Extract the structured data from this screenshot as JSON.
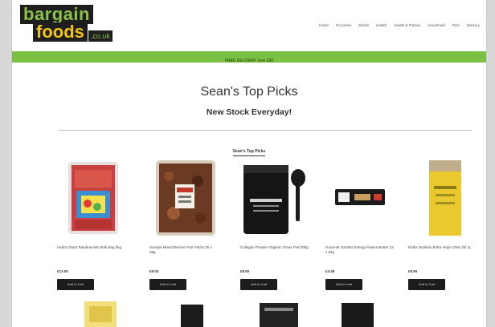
{
  "logo": {
    "line1": "bargain",
    "line2": "foods",
    "domain": ".co.uk"
  },
  "nav": [
    "Home",
    "Groceries",
    "Drinks",
    "Health",
    "Health & Fitness",
    "Household",
    "Pets",
    "Delivery"
  ],
  "banner": {
    "text": "FREE DELIVERY over £50"
  },
  "page": {
    "title": "Sean's Top Picks",
    "subtitle": "New Stock Everyday!",
    "tab": "Sean's Top Picks"
  },
  "products": [
    {
      "name": "Haribo Giant Rainbow Mix Bulk Bag 3kg",
      "price": "£13.00",
      "button": "Add to Cart"
    },
    {
      "name": "Sunripe Mixed Berries Fruit Packs 25 x 35g",
      "price": "£9.00",
      "button": "Add to Cart"
    },
    {
      "name": "Collagen Powder Organic Grass Fed 300g",
      "price": "£8.00",
      "button": "Add to Cart"
    },
    {
      "name": "Gourmet Oat Bar Energy Peanut Butter 12 x 62g",
      "price": "£3.49",
      "button": "Add to Cart"
    },
    {
      "name": "Radix Nutrition Extra Virgin Olive Oil 1L",
      "price": "£9.50",
      "button": "Add to Cart"
    }
  ],
  "colors": {
    "accent_green": "#7ac143",
    "logo_yellow": "#f3c316",
    "button_dark": "#1c1c1c"
  }
}
